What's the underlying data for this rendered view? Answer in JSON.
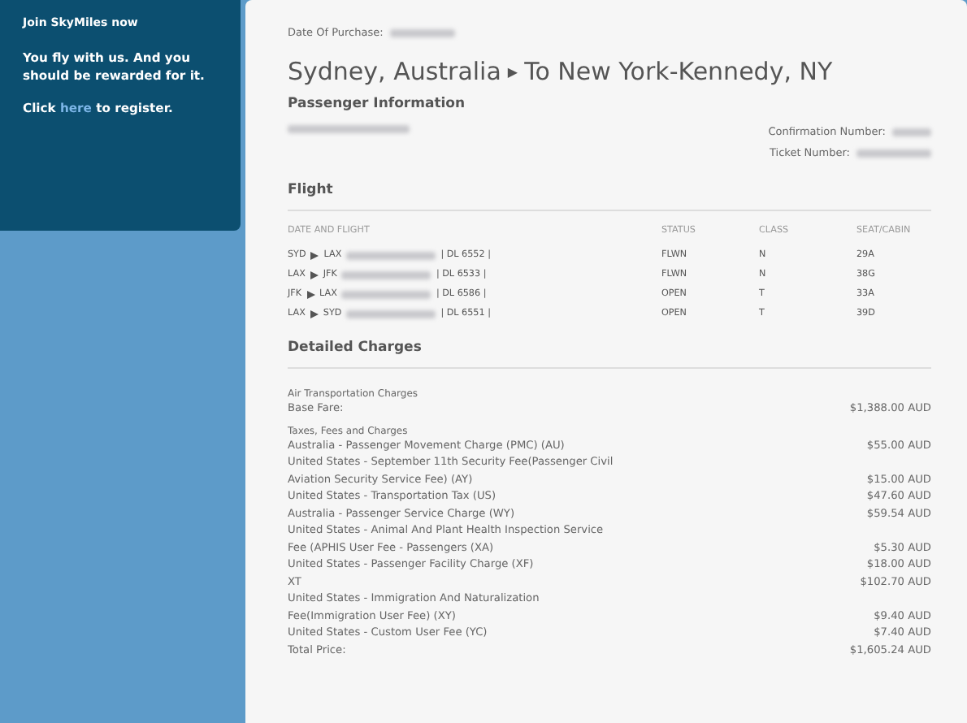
{
  "promo": {
    "heading": "Join SkyMiles now",
    "message": "You fly with us. And you should be rewarded for it.",
    "cta_before": "Click",
    "cta_link": "here",
    "cta_after": "to register."
  },
  "trip": {
    "date_label": "Date Of Purchase:",
    "route_from": "Sydney, Australia",
    "route_arrow": "▶",
    "route_to": "To New York-Kennedy, NY",
    "passenger_heading": "Passenger Information",
    "confirmation_label": "Confirmation Number:",
    "ticket_label": "Ticket Number:"
  },
  "flight": {
    "heading": "Flight",
    "columns": [
      "DATE AND FLIGHT",
      "STATUS",
      "CLASS",
      "SEAT/CABIN"
    ],
    "rows": [
      {
        "from": "SYD",
        "to": "LAX",
        "flight": "| DL 6552 |",
        "status": "FLWN",
        "class": "N",
        "seat": "29A"
      },
      {
        "from": "LAX",
        "to": "JFK",
        "flight": "| DL 6533 |",
        "status": "FLWN",
        "class": "N",
        "seat": "38G"
      },
      {
        "from": "JFK",
        "to": "LAX",
        "flight": "| DL 6586 |",
        "status": "OPEN",
        "class": "T",
        "seat": "33A"
      },
      {
        "from": "LAX",
        "to": "SYD",
        "flight": "| DL 6551 |",
        "status": "OPEN",
        "class": "T",
        "seat": "39D"
      }
    ]
  },
  "charges": {
    "heading": "Detailed Charges",
    "groups": [
      {
        "title": "Air Transportation Charges",
        "items": [
          {
            "lines": [
              "Base Fare:"
            ],
            "amount": "$1,388.00 AUD"
          }
        ]
      },
      {
        "title": "Taxes, Fees and Charges",
        "items": [
          {
            "lines": [
              "Australia - Passenger Movement Charge (PMC) (AU)"
            ],
            "amount": "$55.00 AUD"
          },
          {
            "lines": [
              "United States - September 11th Security Fee(Passenger Civil",
              "Aviation Security Service Fee) (AY)"
            ],
            "amount": "$15.00 AUD"
          },
          {
            "lines": [
              "United States - Transportation Tax (US)"
            ],
            "amount": "$47.60 AUD"
          },
          {
            "lines": [
              "Australia - Passenger Service Charge (WY)"
            ],
            "amount": "$59.54 AUD"
          },
          {
            "lines": [
              "United States - Animal And Plant Health Inspection Service",
              "Fee (APHIS User Fee - Passengers (XA)"
            ],
            "amount": "$5.30 AUD"
          },
          {
            "lines": [
              "United States - Passenger Facility Charge (XF)"
            ],
            "amount": "$18.00 AUD"
          },
          {
            "lines": [
              "XT"
            ],
            "amount": "$102.70 AUD"
          },
          {
            "lines": [
              "United States - Immigration And Naturalization",
              "Fee(Immigration User Fee) (XY)"
            ],
            "amount": "$9.40 AUD"
          },
          {
            "lines": [
              "United States - Custom User Fee (YC)"
            ],
            "amount": "$7.40 AUD"
          }
        ]
      }
    ],
    "total_label": "Total Price:",
    "total_amount": "$1,605.24 AUD"
  }
}
